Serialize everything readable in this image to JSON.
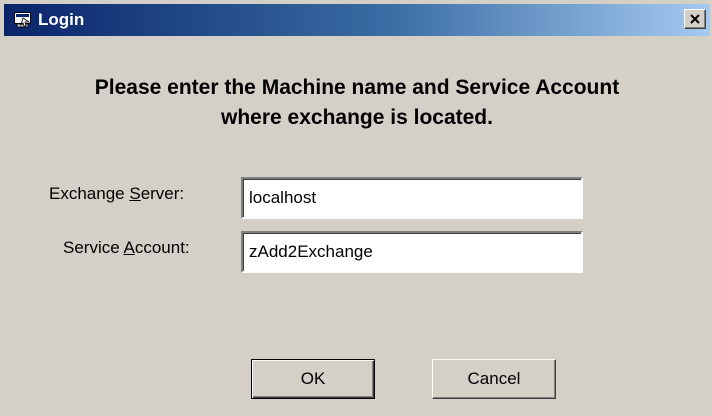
{
  "window": {
    "title": "Login",
    "icon": "login-window-icon",
    "close_icon": "close-icon"
  },
  "heading": {
    "line1": "Please enter the Machine name and Service Account",
    "line2": "where exchange is located."
  },
  "fields": {
    "server": {
      "label_pre": "Exchange ",
      "label_accel": "S",
      "label_post": "erver:",
      "value": "localhost"
    },
    "account": {
      "label_pre": "Service ",
      "label_accel": "A",
      "label_post": "ccount:",
      "value": "zAdd2Exchange"
    }
  },
  "buttons": {
    "ok": "OK",
    "cancel": "Cancel"
  },
  "colors": {
    "dialog_bg": "#d4d0c8",
    "titlebar_start": "#0a246a",
    "titlebar_end": "#a6caf0"
  }
}
